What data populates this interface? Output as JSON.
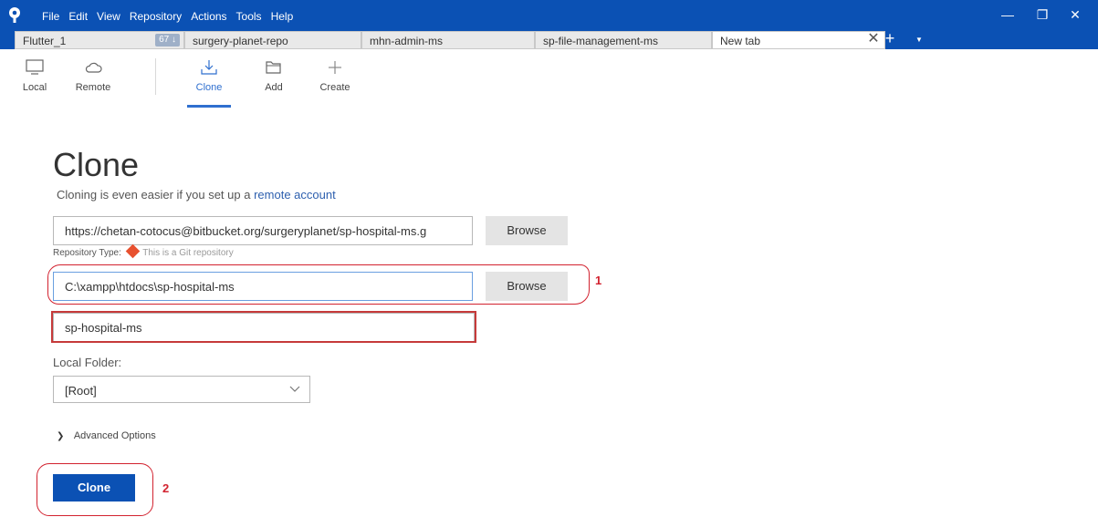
{
  "menu": [
    "File",
    "Edit",
    "View",
    "Repository",
    "Actions",
    "Tools",
    "Help"
  ],
  "window_controls": {
    "minimize": "—",
    "restore": "❐",
    "close": "✕"
  },
  "tabs": [
    {
      "label": "Flutter_1",
      "badge": "67 ↓"
    },
    {
      "label": "surgery-planet-repo"
    },
    {
      "label": "mhn-admin-ms"
    },
    {
      "label": "sp-file-management-ms"
    },
    {
      "label": "New tab",
      "active": true
    }
  ],
  "tab_controls": {
    "close": "✕",
    "add": "+",
    "menu": "▼"
  },
  "toolbar": {
    "local": "Local",
    "remote": "Remote",
    "clone": "Clone",
    "add": "Add",
    "create": "Create"
  },
  "main": {
    "title": "Clone",
    "subtitle_text": "Cloning is even easier if you set up a",
    "subtitle_link": "remote account",
    "source_url": "https://chetan-cotocus@bitbucket.org/surgeryplanet/sp-hospital-ms.g",
    "browse_label": "Browse",
    "repo_type_label": "Repository Type:",
    "repo_type_value": "This is a Git repository",
    "destination_path": "C:\\xampp\\htdocs\\sp-hospital-ms",
    "name": "sp-hospital-ms",
    "local_folder_label": "Local Folder:",
    "local_folder_value": "[Root]",
    "advanced_options": "Advanced Options",
    "clone_button": "Clone"
  },
  "annotations": {
    "one": "1",
    "two": "2"
  },
  "colors": {
    "accent": "#0b51b4",
    "annotation": "#d2222f",
    "link": "#2d5fae"
  }
}
